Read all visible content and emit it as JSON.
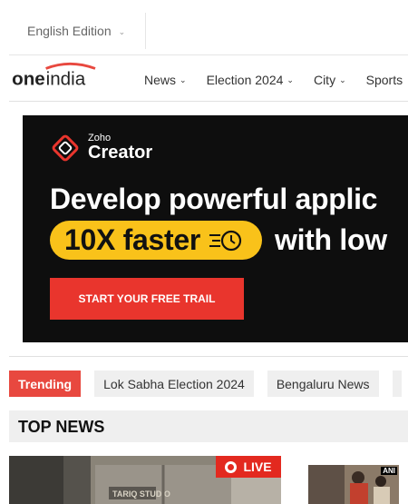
{
  "edition": {
    "label": "English Edition"
  },
  "brand": {
    "logo_text_one": "one",
    "logo_text_india": "india"
  },
  "nav": {
    "items": [
      {
        "label": "News",
        "has_dropdown": true
      },
      {
        "label": "Election 2024",
        "has_dropdown": true
      },
      {
        "label": "City",
        "has_dropdown": true
      },
      {
        "label": "Sports",
        "has_dropdown": false
      }
    ]
  },
  "ad": {
    "brand_line1": "Zoho",
    "brand_line2": "Creator",
    "headline": "Develop powerful applic",
    "pill_text": "10X faster",
    "headline_rest": "with low",
    "cta": "START YOUR FREE TRAIL",
    "colors": {
      "background": "#0e0e0e",
      "pill": "#f9c21a",
      "cta": "#e9352d"
    }
  },
  "trending": {
    "label": "Trending",
    "items": [
      "Lok Sabha Election 2024",
      "Bengaluru News"
    ]
  },
  "top_news": {
    "heading": "TOP NEWS",
    "live_badge": "LIVE",
    "storefront_sign": "TARIQ STUDIO",
    "watermark": "ANI"
  },
  "colors": {
    "accent": "#e8483f",
    "live": "#e3291f",
    "section_bg": "#efefef"
  }
}
